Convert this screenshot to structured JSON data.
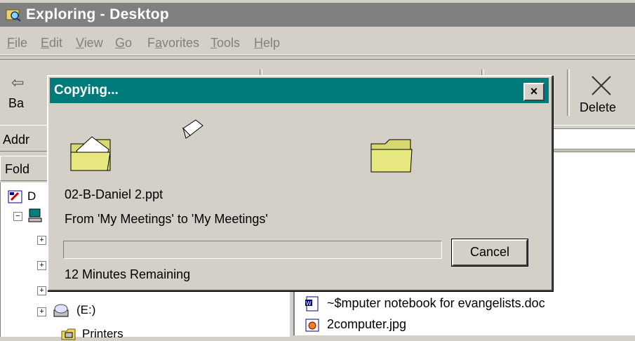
{
  "window": {
    "title": "Exploring - Desktop",
    "icon": "explorer-icon"
  },
  "menu": [
    {
      "label": "File",
      "mnemonic": "F"
    },
    {
      "label": "Edit",
      "mnemonic": "E"
    },
    {
      "label": "View",
      "mnemonic": "V"
    },
    {
      "label": "Go",
      "mnemonic": "G"
    },
    {
      "label": "Favorites",
      "mnemonic": "a"
    },
    {
      "label": "Tools",
      "mnemonic": "T"
    },
    {
      "label": "Help",
      "mnemonic": "H"
    }
  ],
  "toolbar": {
    "back_label": "Ba",
    "delete_label": "Delete"
  },
  "address": {
    "label": "Addr"
  },
  "folders_pane": {
    "header": "Fold",
    "items": [
      {
        "label": "D",
        "icon": "desktop-icon"
      },
      {
        "label": "",
        "icon": "my-computer-icon"
      },
      {
        "label": "",
        "icon": "drive-icon"
      },
      {
        "label": "",
        "icon": "drive-icon"
      },
      {
        "label": "(E:)",
        "icon": "cd-drive-icon"
      },
      {
        "label": "Printers",
        "icon": "printers-icon"
      }
    ]
  },
  "file_list": [
    {
      "name": "~$mputer notebook for evangelists.doc",
      "icon": "word-doc-icon"
    },
    {
      "name": "2computer.jpg",
      "icon": "image-file-icon"
    }
  ],
  "dialog": {
    "title": "Copying...",
    "close_label": "×",
    "file_name": "02-B-Daniel 2.ppt",
    "from_to": "From 'My Meetings' to 'My Meetings'",
    "progress_percent": 3,
    "progress_segments": 2,
    "cancel_label": "Cancel",
    "remaining": "12 Minutes Remaining"
  },
  "colors": {
    "title_inactive": "#808080",
    "dialog_title": "#007b7b",
    "progress": "#007b7b",
    "face": "#d4d0c8"
  }
}
